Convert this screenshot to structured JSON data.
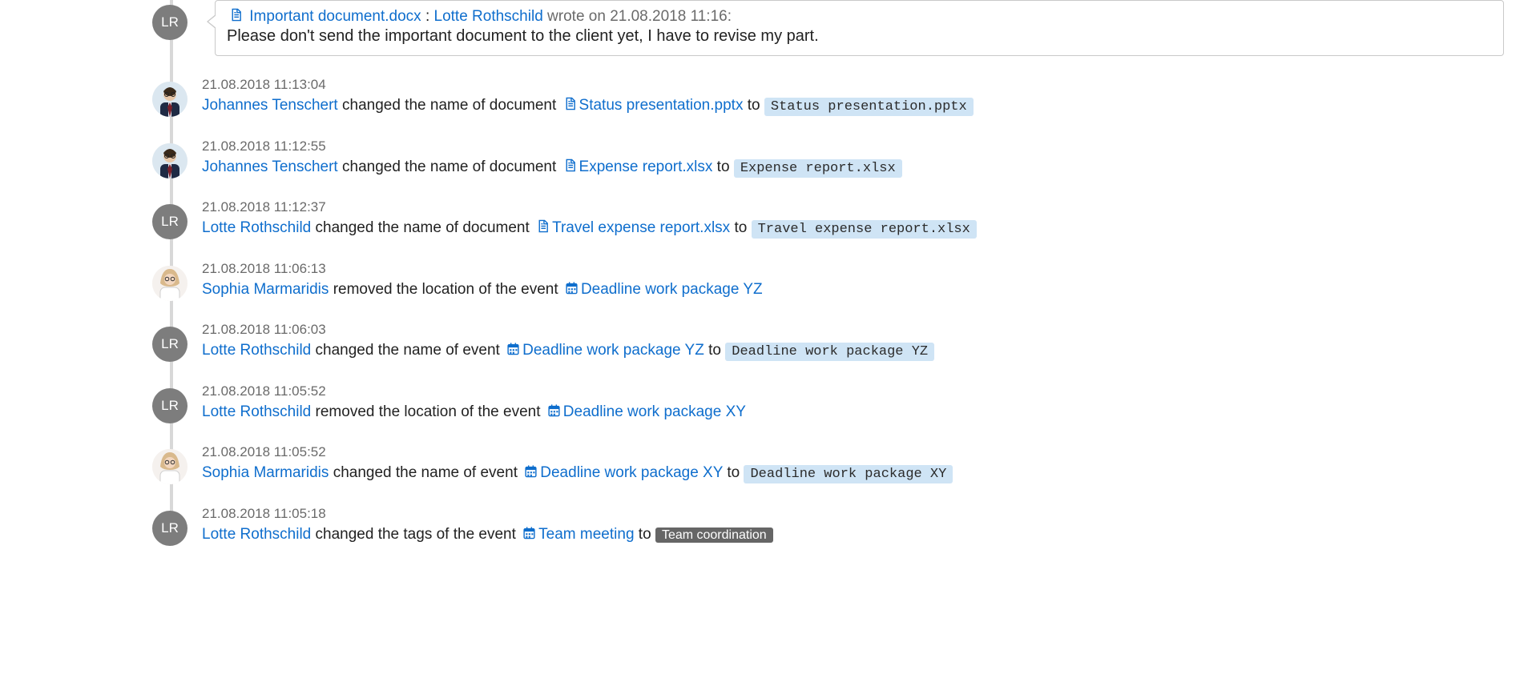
{
  "avatars": {
    "LR": {
      "type": "initials",
      "text": "LR",
      "bg": "#7d7d7d"
    },
    "JT": {
      "type": "photo-male"
    },
    "SM": {
      "type": "photo-female"
    }
  },
  "comment": {
    "avatar": "LR",
    "doc_icon": "document",
    "doc_name": "Important document.docx",
    "author": "Lotte Rothschild",
    "wrote_on": "wrote on",
    "time": "21.08.2018 11:16",
    "body": "Please don't send the important document to the client yet, I have to revise my part."
  },
  "word_to": "to",
  "entries": [
    {
      "avatar": "JT",
      "time": "21.08.2018 11:13:04",
      "actor": "Johannes Tenschert",
      "verb": "changed the name of document",
      "obj_icon": "document",
      "obj": "Status presentation.pptx",
      "has_to": true,
      "new_val": "Status presentation.pptx",
      "new_val_style": "code"
    },
    {
      "avatar": "JT",
      "time": "21.08.2018 11:12:55",
      "actor": "Johannes Tenschert",
      "verb": "changed the name of document",
      "obj_icon": "document",
      "obj": "Expense report.xlsx",
      "has_to": true,
      "new_val": "Expense report.xlsx",
      "new_val_style": "code"
    },
    {
      "avatar": "LR",
      "time": "21.08.2018 11:12:37",
      "actor": "Lotte Rothschild",
      "verb": "changed the name of document",
      "obj_icon": "document",
      "obj": "Travel expense report.xlsx",
      "has_to": true,
      "new_val": "Travel expense report.xlsx",
      "new_val_style": "code"
    },
    {
      "avatar": "SM",
      "time": "21.08.2018 11:06:13",
      "actor": "Sophia Marmaridis",
      "verb": "removed the location of the event",
      "obj_icon": "calendar",
      "obj": "Deadline work package YZ",
      "has_to": false
    },
    {
      "avatar": "LR",
      "time": "21.08.2018 11:06:03",
      "actor": "Lotte Rothschild",
      "verb": "changed the name of event",
      "obj_icon": "calendar",
      "obj": "Deadline work package YZ",
      "has_to": true,
      "new_val": "Deadline work package YZ",
      "new_val_style": "code"
    },
    {
      "avatar": "LR",
      "time": "21.08.2018 11:05:52",
      "actor": "Lotte Rothschild",
      "verb": "removed the location of the event",
      "obj_icon": "calendar",
      "obj": "Deadline work package XY",
      "has_to": false
    },
    {
      "avatar": "SM",
      "time": "21.08.2018 11:05:52",
      "actor": "Sophia Marmaridis",
      "verb": "changed the name of event",
      "obj_icon": "calendar",
      "obj": "Deadline work package XY",
      "has_to": true,
      "new_val": "Deadline work package XY",
      "new_val_style": "code"
    },
    {
      "avatar": "LR",
      "time": "21.08.2018 11:05:18",
      "actor": "Lotte Rothschild",
      "verb": "changed the tags of the event",
      "obj_icon": "calendar",
      "obj": "Team meeting",
      "has_to": true,
      "new_val": "Team coordination",
      "new_val_style": "tag"
    }
  ]
}
